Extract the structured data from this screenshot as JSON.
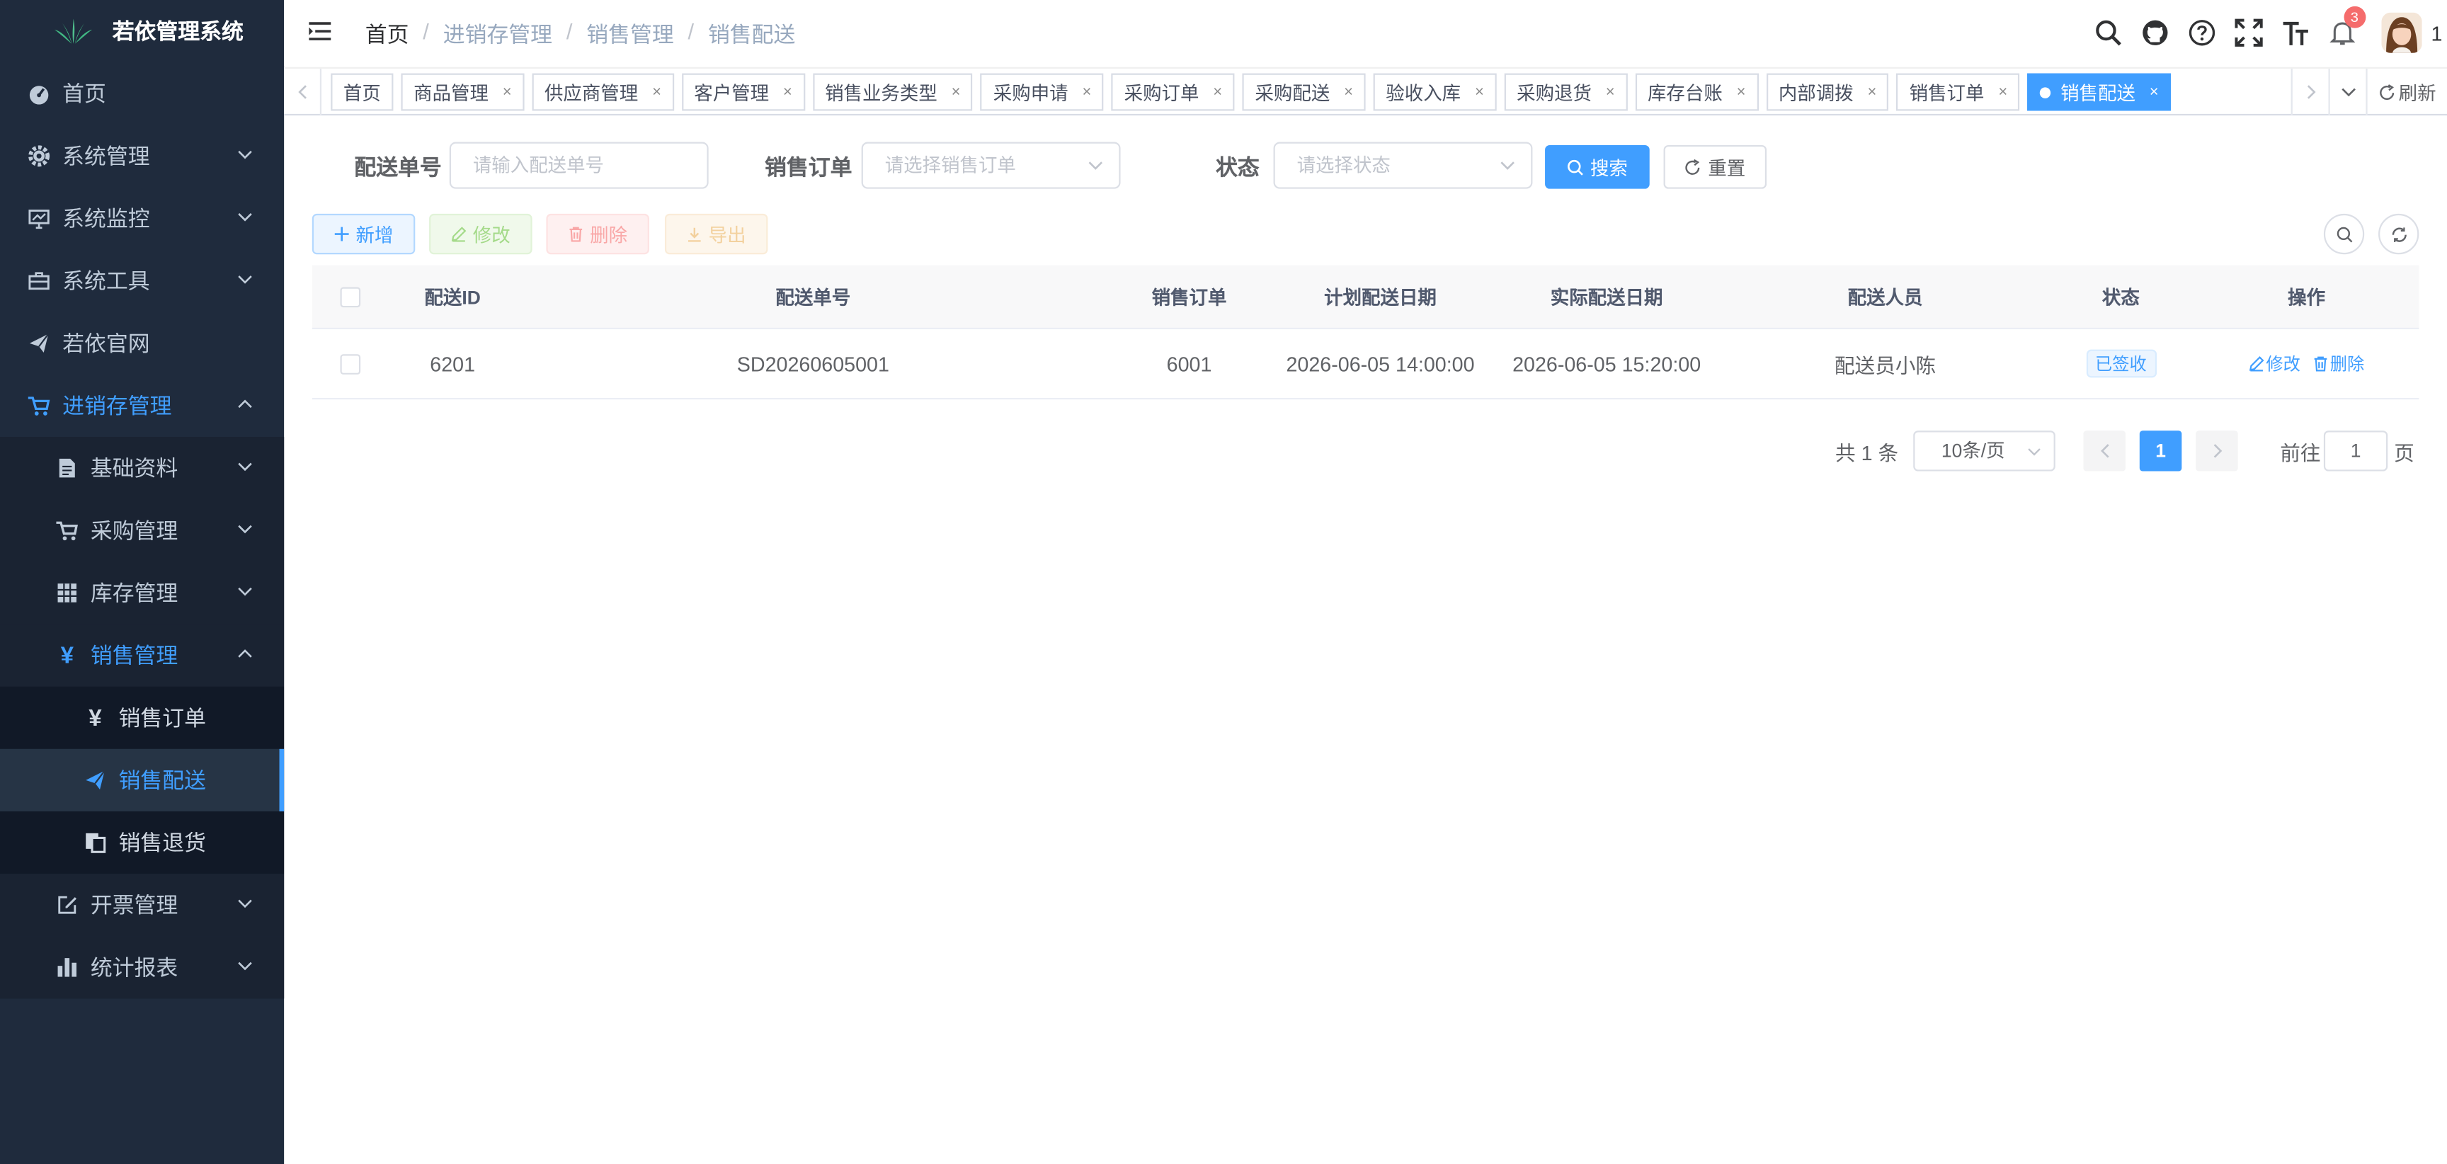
{
  "app": {
    "title": "若依管理系统"
  },
  "sidebar": {
    "items": [
      {
        "label": "首页",
        "icon": "dashboard-icon"
      },
      {
        "label": "系统管理",
        "icon": "gear-icon"
      },
      {
        "label": "系统监控",
        "icon": "monitor-icon"
      },
      {
        "label": "系统工具",
        "icon": "toolbox-icon"
      },
      {
        "label": "若依官网",
        "icon": "send-icon"
      },
      {
        "label": "进销存管理",
        "icon": "cart-icon"
      },
      {
        "label": "基础资料",
        "icon": "document-icon"
      },
      {
        "label": "采购管理",
        "icon": "cart-icon"
      },
      {
        "label": "库存管理",
        "icon": "grid-icon"
      },
      {
        "label": "销售管理",
        "icon": "yen-icon"
      },
      {
        "label": "销售订单",
        "icon": "yen-icon"
      },
      {
        "label": "销售配送",
        "icon": "send-icon"
      },
      {
        "label": "销售退货",
        "icon": "copy-icon"
      },
      {
        "label": "开票管理",
        "icon": "edit-icon"
      },
      {
        "label": "统计报表",
        "icon": "bar-chart-icon"
      }
    ]
  },
  "breadcrumb": [
    "首页",
    "进销存管理",
    "销售管理",
    "销售配送"
  ],
  "navbar": {
    "notification_count": "3",
    "user_label": "1"
  },
  "tags": [
    {
      "label": "首页",
      "closable": false
    },
    {
      "label": "商品管理",
      "closable": true
    },
    {
      "label": "供应商管理",
      "closable": true
    },
    {
      "label": "客户管理",
      "closable": true
    },
    {
      "label": "销售业务类型",
      "closable": true
    },
    {
      "label": "采购申请",
      "closable": true
    },
    {
      "label": "采购订单",
      "closable": true
    },
    {
      "label": "采购配送",
      "closable": true
    },
    {
      "label": "验收入库",
      "closable": true
    },
    {
      "label": "采购退货",
      "closable": true
    },
    {
      "label": "库存台账",
      "closable": true
    },
    {
      "label": "内部调拨",
      "closable": true
    },
    {
      "label": "销售订单",
      "closable": true
    },
    {
      "label": "销售配送",
      "closable": true,
      "active": true
    }
  ],
  "tags_close_symbol": "×",
  "tags_refresh_label": "刷新",
  "search": {
    "delivery_no_label": "配送单号",
    "delivery_no_placeholder": "请输入配送单号",
    "sales_order_label": "销售订单",
    "sales_order_placeholder": "请选择销售订单",
    "status_label": "状态",
    "status_placeholder": "请选择状态",
    "search_button": "搜索",
    "reset_button": "重置"
  },
  "toolbar": {
    "add": "新增",
    "edit": "修改",
    "delete": "删除",
    "export": "导出"
  },
  "table": {
    "columns": [
      "配送ID",
      "配送单号",
      "销售订单",
      "计划配送日期",
      "实际配送日期",
      "配送人员",
      "状态",
      "操作"
    ],
    "rows": [
      {
        "id": "6201",
        "delivery_no": "SD20260605001",
        "sales_order": "6001",
        "planned_date": "2026-06-05 14:00:00",
        "actual_date": "2026-06-05 15:20:00",
        "courier": "配送员小陈",
        "status": "已签收",
        "action_edit": "修改",
        "action_delete": "删除"
      }
    ]
  },
  "pagination": {
    "total_text": "共 1 条",
    "page_size": "10条/页",
    "current_page": "1",
    "goto_label": "前往",
    "goto_value": "1",
    "page_suffix": "页"
  },
  "colors": {
    "primary": "#409eff",
    "sidebar_bg": "#1f2b3d",
    "sidebar_text": "#bfcbd9",
    "badge": "#f56c6c"
  }
}
